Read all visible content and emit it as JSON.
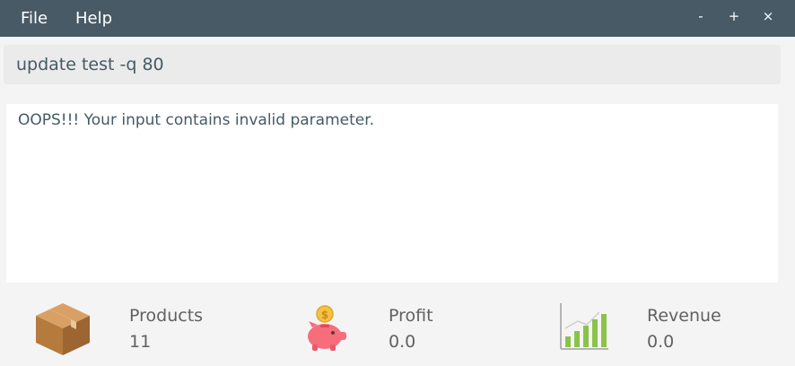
{
  "menu": {
    "file": "File",
    "help": "Help"
  },
  "window_controls": {
    "minimize": "-",
    "maximize": "+",
    "close": "×"
  },
  "command": {
    "value": "update test -q 80"
  },
  "output": {
    "message": "OOPS!!! Your input contains invalid parameter."
  },
  "stats": {
    "products": {
      "label": "Products",
      "value": "11",
      "icon": "box-icon"
    },
    "profit": {
      "label": "Profit",
      "value": "0.0",
      "icon": "piggy-bank-icon"
    },
    "revenue": {
      "label": "Revenue",
      "value": "0.0",
      "icon": "bar-growth-icon"
    }
  },
  "colors": {
    "titlebar": "#475a66",
    "command_bg": "#ebebeb",
    "panel_bg": "#ffffff",
    "text": "#455a64"
  }
}
